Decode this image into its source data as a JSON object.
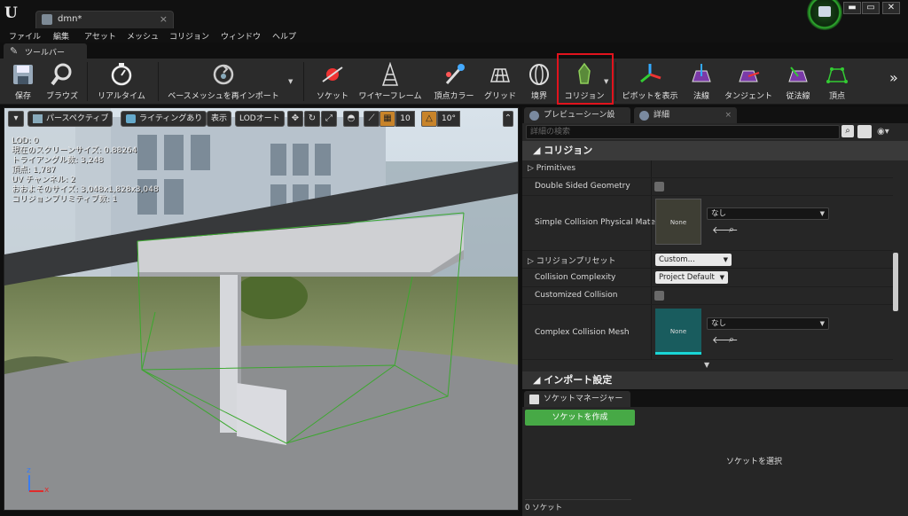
{
  "window": {
    "doc_tab": "dmn*",
    "close": "×",
    "logo": "U",
    "controls": [
      "▬",
      "▭",
      "✕"
    ]
  },
  "menu": [
    "ファイル",
    "編集",
    "アセット",
    "メッシュ",
    "コリジョン",
    "ウィンドウ",
    "ヘルプ"
  ],
  "toolbar_tab": "ツールバー",
  "toolbar": {
    "items": [
      {
        "label": "保存",
        "icon": "save-icon"
      },
      {
        "label": "ブラウズ",
        "icon": "browse-icon"
      },
      {
        "label": "リアルタイム",
        "icon": "realtime-icon"
      },
      {
        "label": "ベースメッシュを再インポート",
        "icon": "reimport-icon"
      },
      {
        "label": "ソケット",
        "icon": "socket-icon"
      },
      {
        "label": "ワイヤーフレーム",
        "icon": "wireframe-icon"
      },
      {
        "label": "頂点カラー",
        "icon": "vertex-color-icon"
      },
      {
        "label": "グリッド",
        "icon": "grid-icon"
      },
      {
        "label": "境界",
        "icon": "bounds-icon"
      },
      {
        "label": "コリジョン",
        "icon": "collision-icon"
      },
      {
        "label": "ピボットを表示",
        "icon": "pivot-icon"
      },
      {
        "label": "法線",
        "icon": "normals-icon"
      },
      {
        "label": "タンジェント",
        "icon": "tangent-icon"
      },
      {
        "label": "従法線",
        "icon": "binormal-icon"
      },
      {
        "label": "頂点",
        "icon": "vertices-icon"
      }
    ],
    "more": "»"
  },
  "viewport": {
    "perspective": "パースペクティブ",
    "lighting": "ライティングあり",
    "show": "表示",
    "lod": "LODオート",
    "grid_snap": "10",
    "rot_snap": "10°",
    "stats": [
      "LOD: 0",
      "現在のスクリーンサイズ: 0.88264",
      "トライアングル数: 3,248",
      "頂点: 1,787",
      "UV チャンネル: 2",
      "おおよそのサイズ: 3,048x1,828x3,048",
      "コリジョンプリミティブ数: 1"
    ],
    "axis_z": "z",
    "axis_x": "x"
  },
  "panel_tabs": {
    "preview": "プレビューシーン設",
    "details": "詳細"
  },
  "details": {
    "search_placeholder": "詳細の検索",
    "collision_header": "コリジョン",
    "primitives": "Primitives",
    "double_sided": "Double Sided Geometry",
    "simple_phys_mat": "Simple Collision Physical Materi",
    "none_label": "None",
    "none_jp": "なし",
    "collision_presets": "コリジョンプリセット",
    "presets_value": "Custom...",
    "complexity": "Collision Complexity",
    "complexity_value": "Project Default",
    "customized": "Customized Collision",
    "complex_mesh": "Complex Collision Mesh",
    "import_header": "インポート設定"
  },
  "sockets": {
    "tab": "ソケットマネージャー",
    "create": "ソケットを作成",
    "select": "ソケットを選択",
    "count": "0 ソケット"
  },
  "colors": {
    "highlight": "#e1131d",
    "create_button": "#47a946",
    "collision_wire": "#3ba82e"
  }
}
